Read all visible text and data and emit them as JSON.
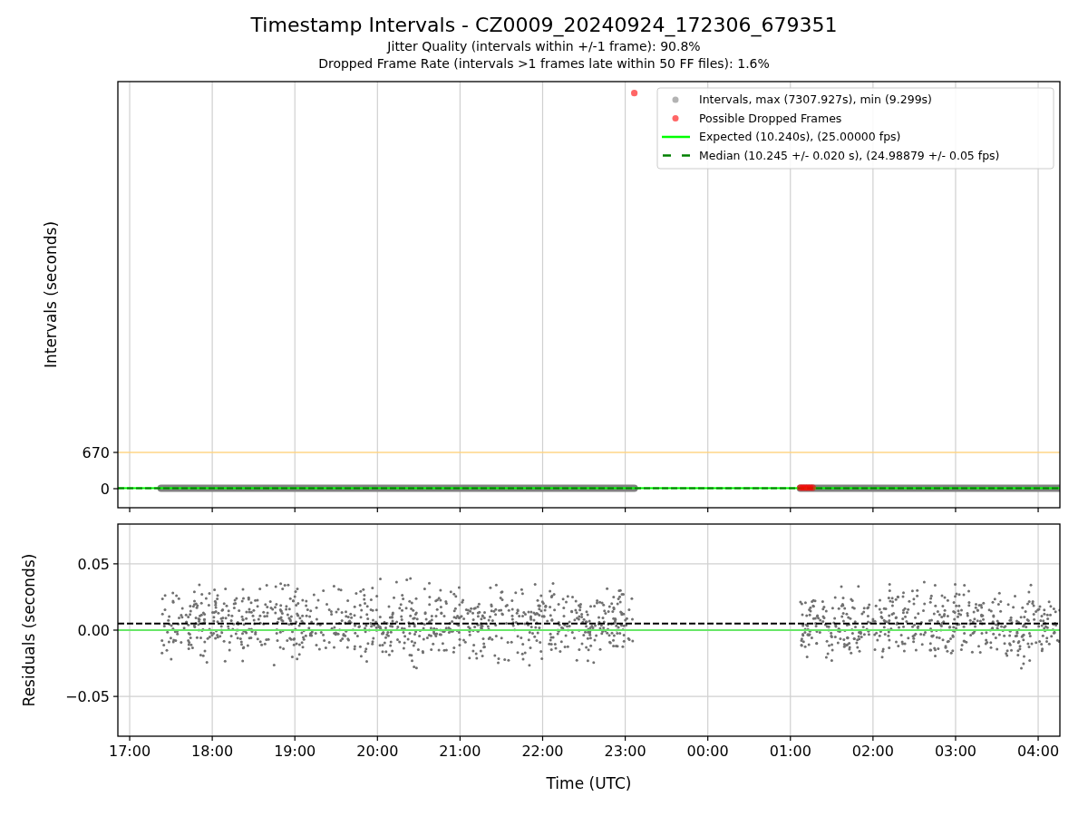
{
  "figure": {
    "title": "Timestamp Intervals - CZ0009_20240924_172306_679351",
    "subtitles": [
      "Jitter Quality (intervals within +/-1 frame): 90.8%",
      "Dropped Frame Rate (intervals >1 frames late within 50 FF files): 1.6%"
    ]
  },
  "intervals_panel": {
    "ylabel": "Intervals (seconds)",
    "yticks": [
      "670",
      "0"
    ],
    "legend": [
      {
        "label": "Intervals, max (7307.927s), min (9.299s)",
        "kind": "dot",
        "color": "#b3b3b3"
      },
      {
        "label": "Possible Dropped Frames",
        "kind": "dot",
        "color": "#ff6666"
      },
      {
        "label": "Expected (10.240s), (25.00000 fps)",
        "kind": "line",
        "color": "#00ff00"
      },
      {
        "label": "Median (10.245 +/- 0.020 s), (24.98879 +/- 0.05 fps)",
        "kind": "dashed-line",
        "color": "#008000"
      }
    ]
  },
  "residuals_panel": {
    "ylabel": "Residuals (seconds)",
    "yticks": [
      "0.05",
      "0.00",
      "−0.05"
    ],
    "xticks": [
      "17:00",
      "18:00",
      "19:00",
      "20:00",
      "21:00",
      "22:00",
      "23:00",
      "00:00",
      "01:00",
      "02:00",
      "03:00",
      "04:00"
    ],
    "xlabel": "Time (UTC)"
  }
}
